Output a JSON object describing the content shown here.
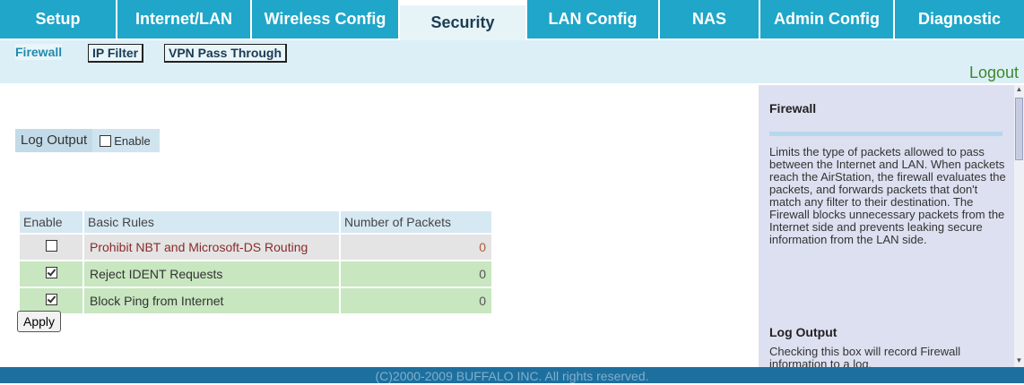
{
  "nav": {
    "tabs": [
      {
        "label": "Setup"
      },
      {
        "label": "Internet/LAN"
      },
      {
        "label": "Wireless Config"
      },
      {
        "label": "Security"
      },
      {
        "label": "LAN Config"
      },
      {
        "label": "NAS"
      },
      {
        "label": "Admin Config"
      },
      {
        "label": "Diagnostic"
      }
    ],
    "active": "Security"
  },
  "subnav": {
    "tabs": [
      {
        "label": "Firewall"
      },
      {
        "label": "IP Filter"
      },
      {
        "label": "VPN Pass Through"
      }
    ],
    "active": "Firewall",
    "logout": "Logout"
  },
  "log_output": {
    "label": "Log Output",
    "enable_label": "Enable",
    "checked": false
  },
  "rules_table": {
    "headers": [
      "Enable",
      "Basic Rules",
      "Number of Packets"
    ],
    "rows": [
      {
        "enabled": false,
        "name": "Prohibit NBT and Microsoft-DS Routing",
        "packets": "0"
      },
      {
        "enabled": true,
        "name": "Reject IDENT Requests",
        "packets": "0"
      },
      {
        "enabled": true,
        "name": "Block Ping from Internet",
        "packets": "0"
      }
    ]
  },
  "apply_label": "Apply",
  "help": {
    "title": "Firewall",
    "text": "Limits the type of packets allowed to pass between the Internet and LAN. When packets reach the AirStation, the firewall evaluates the packets, and forwards packets that don't match any filter to their destination. The Firewall blocks unnecessary packets from the Internet side and prevents leaking secure information from the LAN side.",
    "section_title": "Log Output",
    "section_text": "Checking this box will record Firewall information to a log."
  },
  "footer": "(C)2000-2009 BUFFALO INC. All rights reserved.",
  "colors": {
    "tab_bg": "#1fa6c9",
    "active_tab_bg": "#e6f4f8",
    "footer_bg": "#1d6f9e",
    "logout": "#3b8a2c",
    "help_bg": "#dde0f0"
  }
}
